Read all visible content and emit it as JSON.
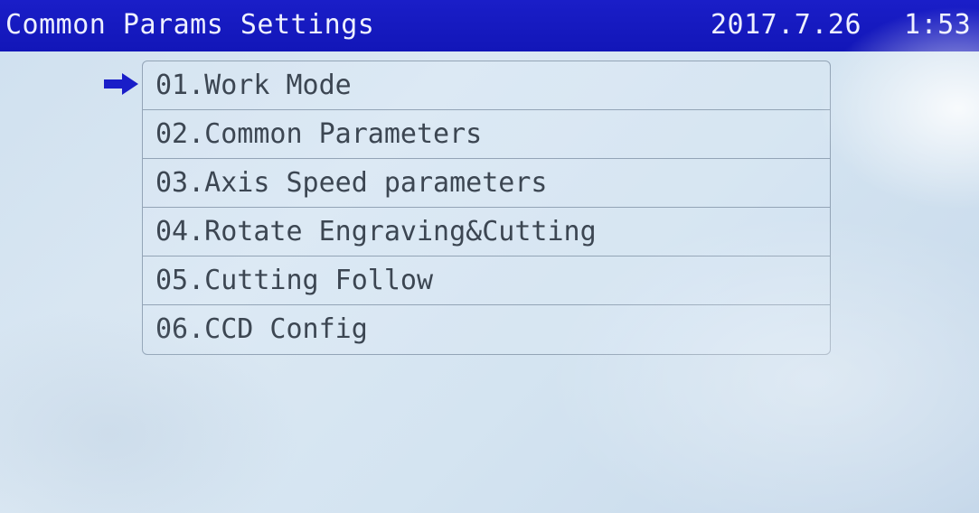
{
  "header": {
    "title": "Common Params Settings",
    "date": "2017.7.26",
    "time": "1:53"
  },
  "menu": {
    "selected_index": 0,
    "items": [
      {
        "label": "01.Work Mode"
      },
      {
        "label": "02.Common Parameters"
      },
      {
        "label": "03.Axis Speed parameters"
      },
      {
        "label": "04.Rotate Engraving&Cutting"
      },
      {
        "label": "05.Cutting Follow"
      },
      {
        "label": "06.CCD Config"
      }
    ]
  },
  "colors": {
    "title_bar": "#1a1ec8",
    "title_text": "#eef0ff",
    "selection_arrow": "#1a1ec8",
    "menu_text": "#3c4652",
    "menu_border": "#93a4b6"
  },
  "icons": {
    "selection": "arrow-right-icon"
  }
}
